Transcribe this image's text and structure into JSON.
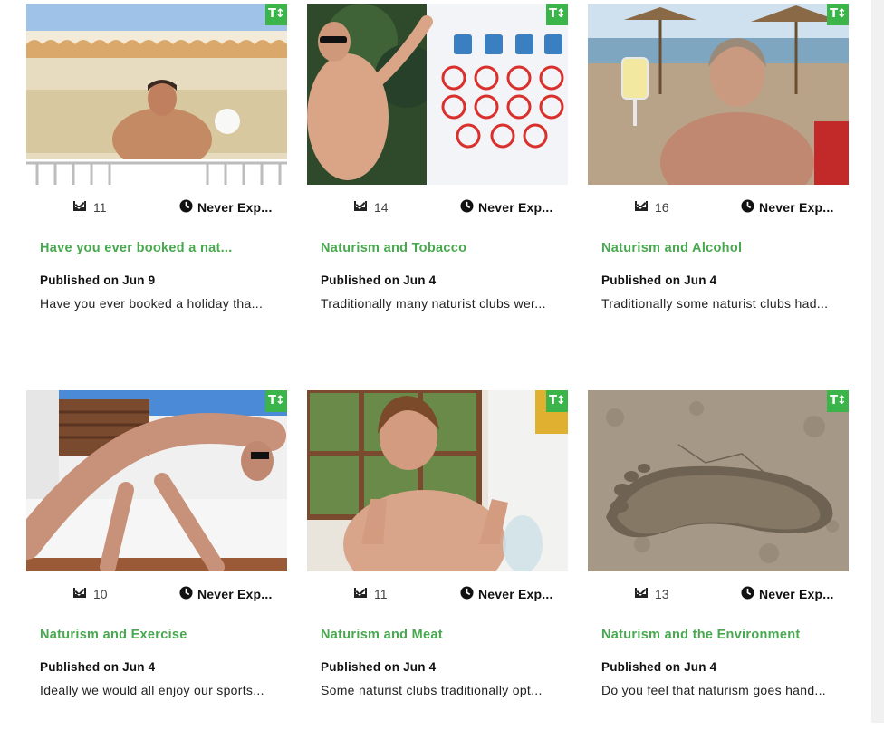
{
  "colors": {
    "accent": "#48a84f",
    "badge": "#3bb54a"
  },
  "badge_icon": "text-sort-icon",
  "badge_text": "T↕",
  "count_icon": "inbox-check-icon",
  "expiry_icon": "clock-icon",
  "cards": [
    {
      "count": "11",
      "expiry": "Never Exp...",
      "title": "Have you ever booked a nat...",
      "published": "Published on Jun 9",
      "excerpt": "Have you ever booked a holiday tha..."
    },
    {
      "count": "14",
      "expiry": "Never Exp...",
      "title": "Naturism and Tobacco",
      "published": "Published on Jun 4",
      "excerpt": "Traditionally many naturist clubs wer..."
    },
    {
      "count": "16",
      "expiry": "Never Exp...",
      "title": "Naturism and Alcohol",
      "published": "Published on Jun 4",
      "excerpt": "Traditionally some naturist clubs had..."
    },
    {
      "count": "10",
      "expiry": "Never Exp...",
      "title": "Naturism and Exercise",
      "published": "Published on Jun 4",
      "excerpt": "Ideally we would all enjoy our sports..."
    },
    {
      "count": "11",
      "expiry": "Never Exp...",
      "title": "Naturism and Meat",
      "published": "Published on Jun 4",
      "excerpt": "Some naturist clubs traditionally opt..."
    },
    {
      "count": "13",
      "expiry": "Never Exp...",
      "title": "Naturism and the Environment",
      "published": "Published on Jun 4",
      "excerpt": "Do you feel that naturism goes hand..."
    }
  ]
}
